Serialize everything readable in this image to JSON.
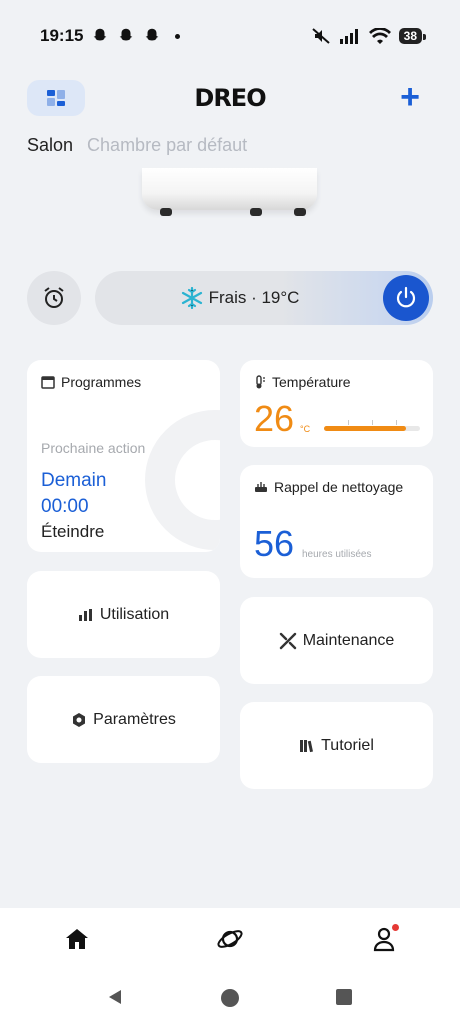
{
  "status_bar": {
    "time": "19:15",
    "battery": "38"
  },
  "header": {
    "logo": "DREO",
    "add_label": "+"
  },
  "rooms": [
    {
      "label": "Salon",
      "active": true
    },
    {
      "label": "Chambre par défaut",
      "active": false
    }
  ],
  "control": {
    "mode_label": "Frais · 19°C",
    "power_on": true
  },
  "cards": {
    "schedule": {
      "title": "Programmes",
      "next_action_label": "Prochaine action",
      "day": "Demain",
      "time": "00:00",
      "action": "Éteindre"
    },
    "temperature": {
      "title": "Température",
      "value": "26",
      "unit": "°C",
      "level": 0.85
    },
    "cleaning": {
      "title": "Rappel de nettoyage",
      "value": "56",
      "unit": "heures utilisées"
    },
    "usage": {
      "label": "Utilisation"
    },
    "maintenance": {
      "label": "Maintenance"
    },
    "settings": {
      "label": "Paramètres"
    },
    "tutorial": {
      "label": "Tutoriel"
    }
  },
  "colors": {
    "accent": "#1b5fd6",
    "temperature": "#f08b14",
    "background": "#f0f2f5"
  },
  "bottom_nav": [
    {
      "icon": "home-icon",
      "active": true
    },
    {
      "icon": "planet-icon",
      "active": false
    },
    {
      "icon": "profile-icon",
      "active": false,
      "badge": true
    }
  ]
}
